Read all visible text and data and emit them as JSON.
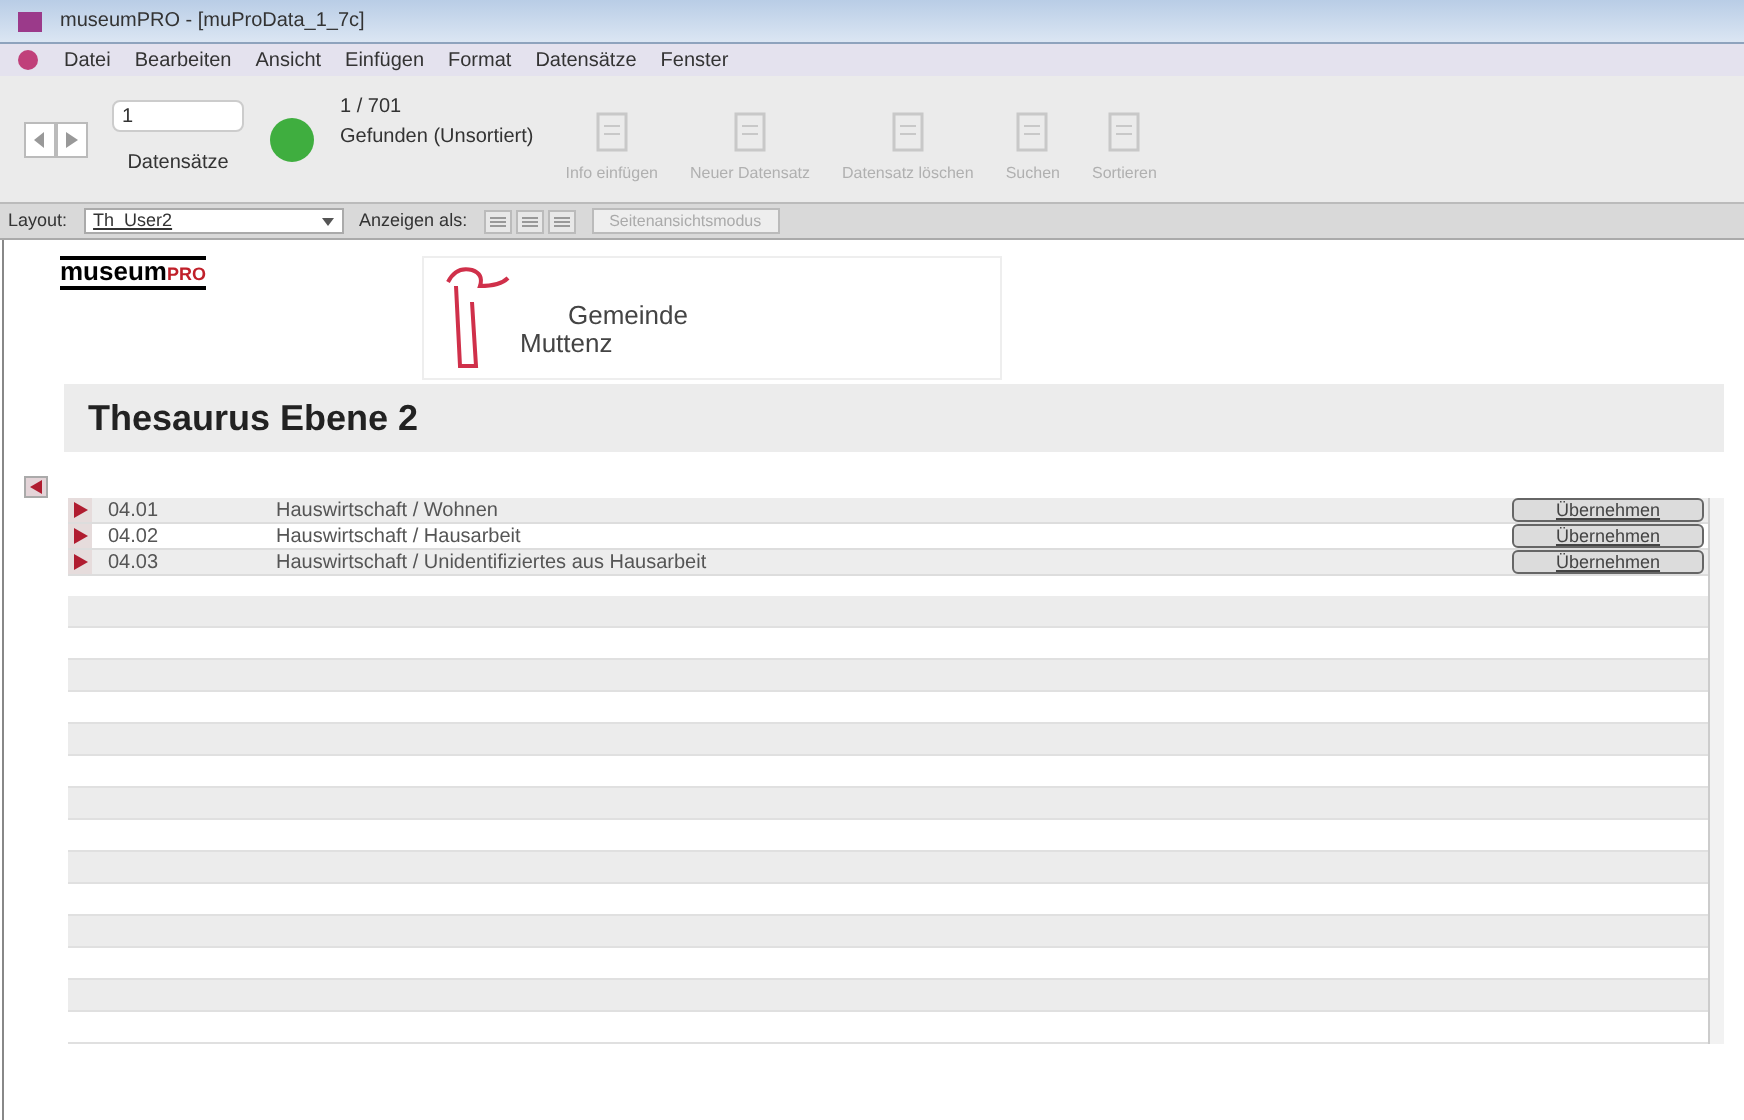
{
  "window": {
    "title": "museumPRO - [muProData_1_7c]"
  },
  "menu": [
    "Datei",
    "Bearbeiten",
    "Ansicht",
    "Einfügen",
    "Format",
    "Datensätze",
    "Fenster"
  ],
  "toolbar": {
    "record_field": "1",
    "record_label": "Datensätze",
    "count": "1 / 701",
    "found": "Gefunden (Unsortiert)",
    "buttons": [
      {
        "label": "Info einfügen",
        "disabled": true
      },
      {
        "label": "Neuer Datensatz",
        "disabled": true
      },
      {
        "label": "Datensatz löschen",
        "disabled": true
      },
      {
        "label": "Suchen",
        "disabled": true
      },
      {
        "label": "Sortieren",
        "disabled": true
      }
    ]
  },
  "layout_bar": {
    "label": "Layout:",
    "layout": "Th_User2",
    "view_label": "Anzeigen als:",
    "preview": "Seitenansichtsmodus"
  },
  "header": {
    "logo_left": "museum",
    "logo_left_accent": "PRO",
    "logo_right_line1": "Gemeinde",
    "logo_right_line2": "Muttenz",
    "title": "Thesaurus Ebene 2"
  },
  "rows": [
    {
      "code": "04.01",
      "name": "Hauswirtschaft / Wohnen",
      "button": "Übernehmen"
    },
    {
      "code": "04.02",
      "name": "Hauswirtschaft / Hausarbeit",
      "button": "Übernehmen"
    },
    {
      "code": "04.03",
      "name": "Hauswirtschaft / Unidentifiziertes aus Hausarbeit",
      "button": "Übernehmen"
    }
  ]
}
